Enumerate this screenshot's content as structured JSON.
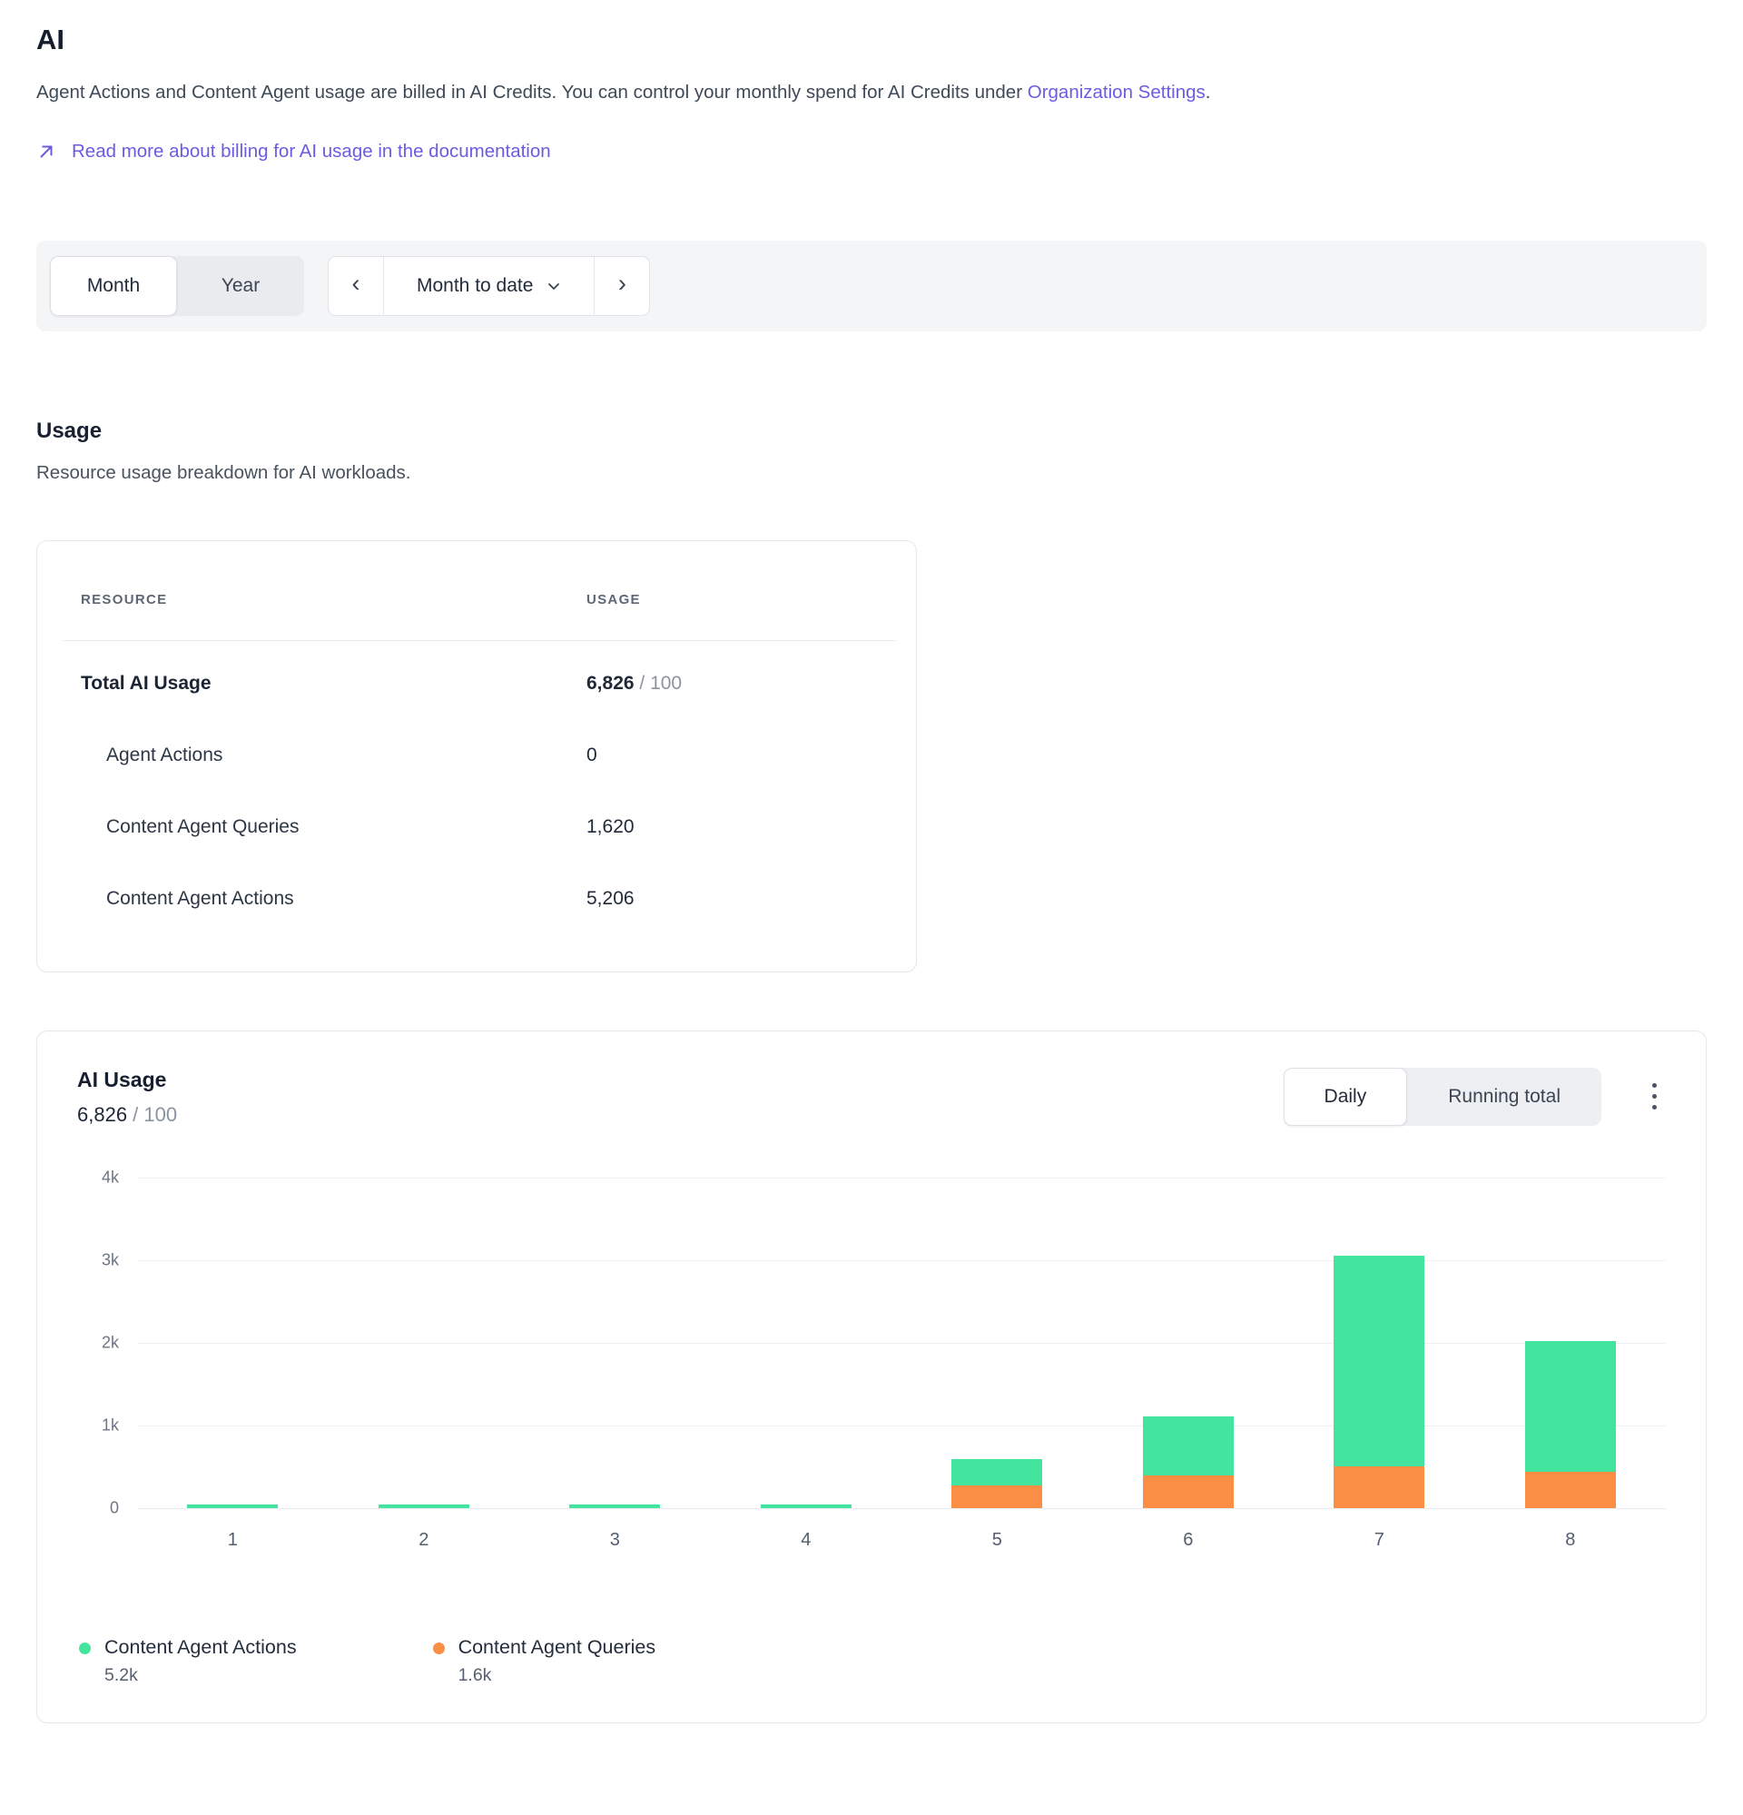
{
  "page": {
    "title": "AI",
    "description_before_link": "Agent Actions and Content Agent usage are billed in AI Credits. You can control your monthly spend for AI Credits under ",
    "description_link": "Organization Settings",
    "description_after_link": ".",
    "doc_link_label": "Read more about billing for AI usage in the documentation"
  },
  "icons": {
    "external_link_icon": "arrow-up-right ↗",
    "prev_icon": "‹",
    "next_icon": "›",
    "dropdown_icon": "chevron-down ⌄",
    "menu_icon": "kebab ⋮"
  },
  "colors": {
    "accent_link": "#6a5ce0",
    "toolbar_bg": "#f4f5f7",
    "green_series": "#43e59e",
    "orange_series": "#fa8e44"
  },
  "toolbar": {
    "period_toggle": [
      {
        "label": "Month",
        "selected": true
      },
      {
        "label": "Year",
        "selected": false
      }
    ],
    "prev_label": "‹",
    "range_label": "Month to date",
    "next_label": "›"
  },
  "usage_section": {
    "heading": "Usage",
    "subtitle": "Resource usage breakdown for AI workloads.",
    "table": {
      "columns": [
        "RESOURCE",
        "USAGE"
      ],
      "rows": [
        {
          "label": "Total AI Usage",
          "value": "6,826",
          "suffix": " / 100"
        },
        {
          "label": "Agent Actions",
          "value": "0",
          "suffix": ""
        },
        {
          "label": "Content Agent Queries",
          "value": "1,620",
          "suffix": ""
        },
        {
          "label": "Content Agent Actions",
          "value": "5,206",
          "suffix": ""
        }
      ]
    }
  },
  "chart_card": {
    "title": "AI Usage",
    "total_value": "6,826",
    "total_suffix": " / 100",
    "view_toggle": [
      {
        "label": "Daily",
        "selected": true
      },
      {
        "label": "Running total",
        "selected": false
      }
    ]
  },
  "chart_data": {
    "type": "bar",
    "stacked": true,
    "title": "AI Usage",
    "xlabel": "",
    "ylabel": "",
    "categories": [
      "1",
      "2",
      "3",
      "4",
      "5",
      "6",
      "7",
      "8"
    ],
    "series": [
      {
        "name": "Content Agent Queries",
        "color": "#fa8e44",
        "values": [
          0,
          0,
          0,
          0,
          280,
          400,
          500,
          440
        ]
      },
      {
        "name": "Content Agent Actions",
        "color": "#43e59e",
        "values": [
          10,
          18,
          6,
          6,
          320,
          710,
          2550,
          1586
        ]
      }
    ],
    "ylim": [
      0,
      4000
    ],
    "y_ticks": [
      {
        "label": "4k",
        "value": 4000
      },
      {
        "label": "3k",
        "value": 3000
      },
      {
        "label": "2k",
        "value": 2000
      },
      {
        "label": "1k",
        "value": 1000
      },
      {
        "label": "0",
        "value": 0
      }
    ],
    "grid": true,
    "legend_position": "bottom",
    "legend": [
      {
        "name": "Content Agent Actions",
        "total": "5.2k",
        "color": "#43e59e"
      },
      {
        "name": "Content Agent Queries",
        "total": "1.6k",
        "color": "#fa8e44"
      }
    ]
  }
}
